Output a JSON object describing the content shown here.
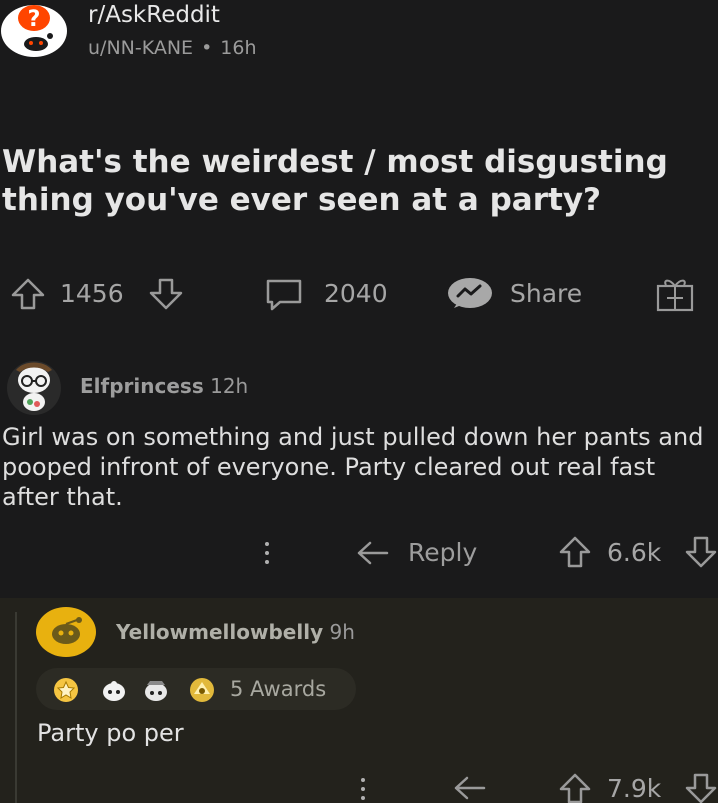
{
  "post": {
    "subreddit": "r/AskReddit",
    "author": "u/NN-KANE",
    "separator": "•",
    "age": "16h",
    "title": "What's the weirdest / most disgusting thing you've ever seen at a party?",
    "upvotes": "1456",
    "comments": "2040",
    "share_label": "Share"
  },
  "comments": [
    {
      "author": "Elfprincess",
      "age": "12h",
      "body": "Girl was on something and just pulled down her pants and pooped infront of everyone. Party cleared out real fast after that.",
      "reply_label": "Reply",
      "score": "6.6k"
    },
    {
      "author": "Yellowmellowbelly",
      "age": "9h",
      "awards": "5 Awards",
      "body": "Party po   per",
      "score": "7.9k"
    }
  ],
  "icons": [
    "reddit-question-icon",
    "upvote-icon",
    "downvote-icon",
    "comment-icon",
    "share-icon",
    "gift-icon",
    "more-icon",
    "reply-icon",
    "award-icon"
  ],
  "colors": {
    "background": "#1a1a1b",
    "reply_panel": "#23221c",
    "avatar_yellow": "#e8b10f"
  }
}
